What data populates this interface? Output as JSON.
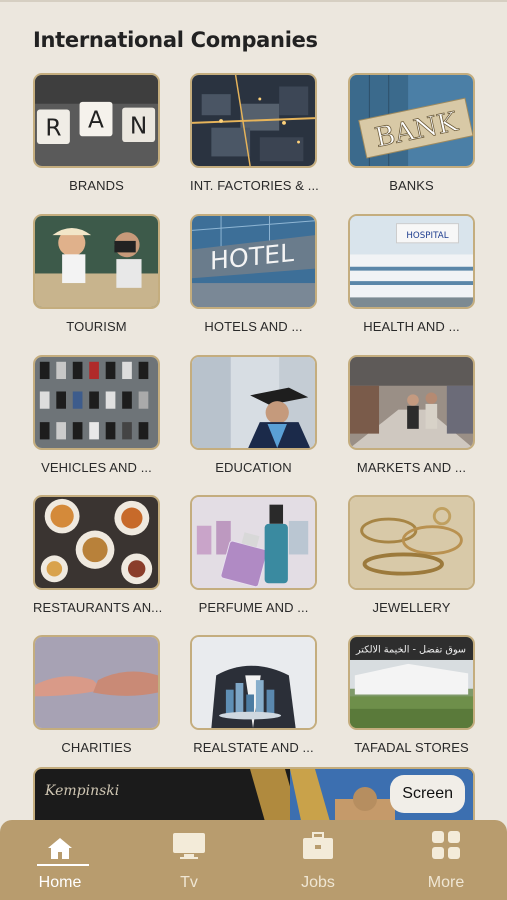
{
  "header": {
    "title": "International Companies"
  },
  "categories": [
    {
      "label": "BRANDS"
    },
    {
      "label": "INT. FACTORIES & ..."
    },
    {
      "label": "BANKS"
    },
    {
      "label": "TOURISM"
    },
    {
      "label": "HOTELS AND ..."
    },
    {
      "label": "HEALTH AND ..."
    },
    {
      "label": "VEHICLES AND ..."
    },
    {
      "label": "EDUCATION"
    },
    {
      "label": "MARKETS AND ..."
    },
    {
      "label": "RESTAURANTS  AN..."
    },
    {
      "label": "PERFUME AND ..."
    },
    {
      "label": "JEWELLERY"
    },
    {
      "label": "CHARITIES"
    },
    {
      "label": "REALSTATE AND ..."
    },
    {
      "label": "TAFADAL STORES"
    }
  ],
  "thumb_text": {
    "brands_letters": [
      "R",
      "A",
      "N"
    ],
    "bank_sign": "BANK",
    "hotel_sign": "HOTEL",
    "hospital_sign": "HOSPITAL",
    "store_sign": "سوق تفضل - الخيمة الالكتر"
  },
  "banner": {
    "logo_text": "Kempinski",
    "screen_button": "Screen"
  },
  "tabbar": {
    "tabs": [
      {
        "label": "Home",
        "icon": "home-icon",
        "active": true
      },
      {
        "label": "Tv",
        "icon": "tv-icon",
        "active": false
      },
      {
        "label": "Jobs",
        "icon": "briefcase-icon",
        "active": false
      },
      {
        "label": "More",
        "icon": "grid-icon",
        "active": false
      }
    ]
  }
}
